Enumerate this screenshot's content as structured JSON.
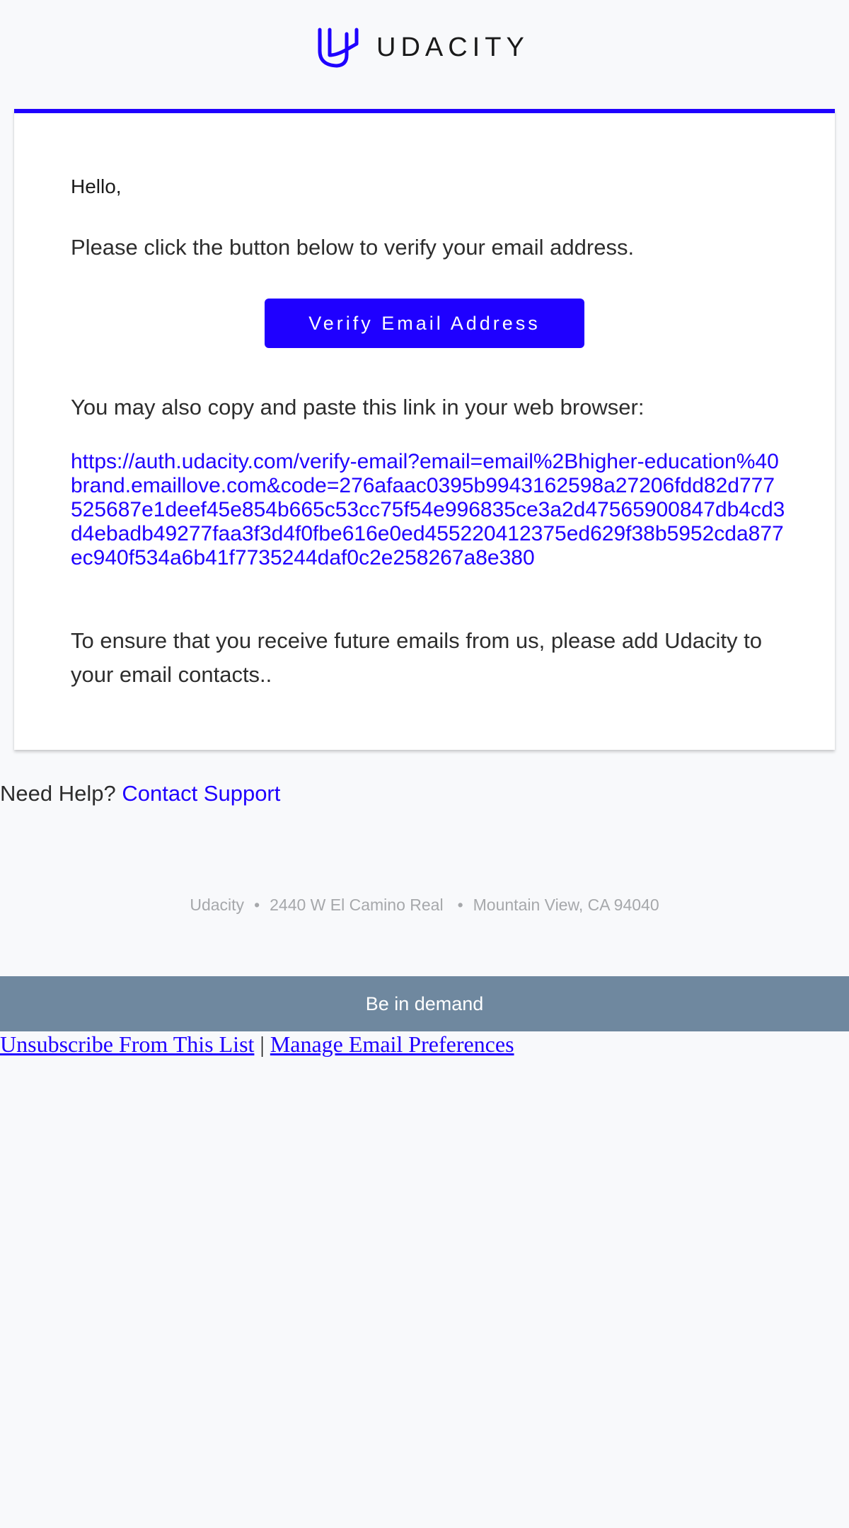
{
  "header": {
    "brand_name": "UDACITY",
    "logo_icon": "udacity-u-logo-icon"
  },
  "email": {
    "greeting": "Hello,",
    "instructions": "Please click the button below to verify your email address.",
    "verify_button_label": "Verify Email Address",
    "copy_link_text": "You may also copy and paste this link in your web browser:",
    "verify_url": "https://auth.udacity.com/verify-email?email=email%2Bhigher-education%40brand.emaillove.com&code=276afaac0395b9943162598a27206fdd82d777525687e1deef45e854b665c53cc75f54e996835ce3a2d47565900847db4cd3d4ebadb49277faa3f3d4f0fbe616e0ed455220412375ed629f38b5952cda877ec940f534a6b41f7735244daf0c2e258267a8e380",
    "contacts_note": "To ensure that you receive future emails from us, please add Udacity to your email contacts.."
  },
  "help": {
    "prefix": "Need Help?",
    "link_label": "Contact Support"
  },
  "footer": {
    "company": "Udacity",
    "street": "2440 W El Camino Real",
    "city": "Mountain View, CA 94040",
    "separator": "•",
    "banner_text": "Be in demand",
    "unsubscribe_label": "Unsubscribe From This List",
    "link_separator": "|",
    "preferences_label": "Manage Email Preferences"
  },
  "colors": {
    "accent": "#1f00ff",
    "background": "#f8f9fb",
    "banner": "#6f889f",
    "muted_text": "#a6a8ab"
  }
}
